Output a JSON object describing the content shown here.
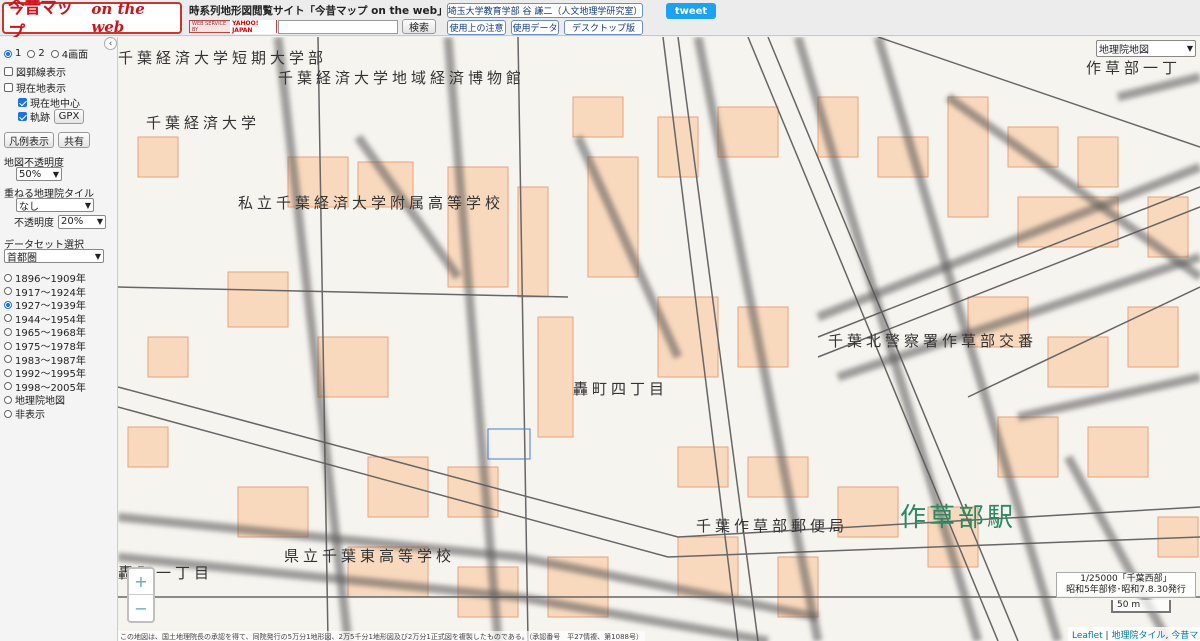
{
  "header": {
    "logo_jp": "今昔マップ",
    "logo_en": "on the web",
    "site_title": "時系列地形図閲覧サイト「今昔マップ on the web」",
    "yahoo_badge_prefix": "WEB SERVICE BY",
    "yahoo_badge_brand": "YAHOO! JAPAN",
    "search_value": "",
    "search_button": "検索",
    "author_link": "埼玉大学教育学部 谷 謙二（人文地理学研究室）",
    "usage_notes": "使用上の注意",
    "usage_data": "使用データ",
    "desktop_version": "デスクトップ版",
    "tweet": "tweet"
  },
  "sidebar": {
    "screen_modes": [
      {
        "label": "1",
        "selected": true
      },
      {
        "label": "2",
        "selected": false
      },
      {
        "label": "4画面",
        "selected": false
      }
    ],
    "grid_lines": "図郭線表示",
    "current_location": "現在地表示",
    "center_on_location": "現在地中心",
    "track": "軌跡",
    "gpx": "GPX",
    "legend_button": "凡例表示",
    "share_button": "共有",
    "map_opacity_label": "地図不透明度",
    "map_opacity_value": "50%",
    "overlay_tile_label": "重ねる地理院タイル",
    "overlay_tile_value": "なし",
    "overlay_opacity_label": "不透明度",
    "overlay_opacity_value": "20%",
    "dataset_label": "データセット選択",
    "dataset_value": "首都圏",
    "periods": [
      {
        "label": "1896〜1909年",
        "selected": false
      },
      {
        "label": "1917〜1924年",
        "selected": false
      },
      {
        "label": "1927〜1939年",
        "selected": true
      },
      {
        "label": "1944〜1954年",
        "selected": false
      },
      {
        "label": "1965〜1968年",
        "selected": false
      },
      {
        "label": "1975〜1978年",
        "selected": false
      },
      {
        "label": "1983〜1987年",
        "selected": false
      },
      {
        "label": "1992〜1995年",
        "selected": false
      },
      {
        "label": "1998〜2005年",
        "selected": false
      },
      {
        "label": "地理院地図",
        "selected": false
      },
      {
        "label": "非表示",
        "selected": false
      }
    ]
  },
  "map": {
    "basemap_select": "地理院地図",
    "labels": {
      "univ_junior": "千葉経済大学短期大学部",
      "univ_museum": "千葉経済大学地域経済博物館",
      "univ": "千葉経済大学",
      "high_school": "私立千葉経済大学附属高等学校",
      "police": "千葉北警察署作草部交番",
      "todoroki": "轟町四丁目",
      "post_office": "千葉作草部郵便局",
      "station": "作草部駅",
      "prefectural_school": "県立千葉東高等学校",
      "todoroki1": "轟町一丁目",
      "sakusabe1": "作草部一丁"
    },
    "zoom_in": "+",
    "zoom_out": "−",
    "info_line1": "1/25000「千葉西部」",
    "info_line2": "昭和5年部修･昭和7.8.30発行",
    "scale": "50 m",
    "attribution_leaflet": "Leaflet",
    "attribution_sep": "|",
    "attribution_tiles": "地理院タイル",
    "attribution_comma": ",",
    "attribution_konjaku": "今昔マップ",
    "footer_note": "この地図は、国土地理院長の承認を得て、同院発行の5万分1地形図、2万5千分1地形図及び2万分1正式図を複製したものである。（承認番号　平27情複、第1088号）"
  }
}
